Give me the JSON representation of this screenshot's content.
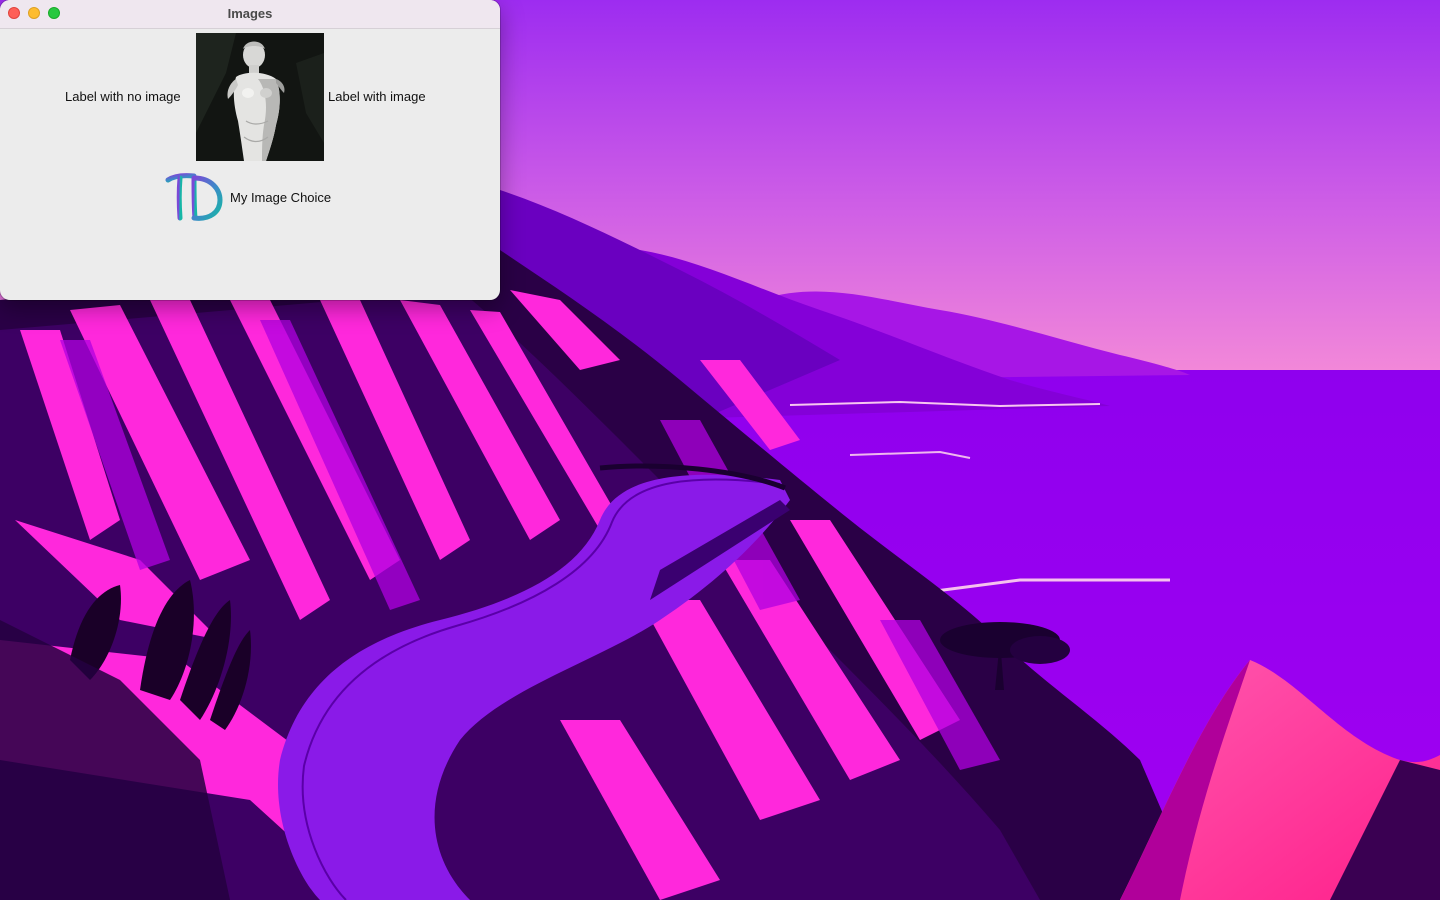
{
  "window": {
    "title": "Images"
  },
  "labels": {
    "no_image": "Label with no image",
    "with_image": "Label with image",
    "choice": "My Image Choice"
  },
  "images": {
    "statue": "statue-photo",
    "logo": "td-logo"
  },
  "colors": {
    "window_bg": "#ececec",
    "titlebar_bg": "#efe7ef",
    "close": "#fe5f57",
    "minimize": "#febc2e",
    "maximize": "#28c840",
    "sky_top": "#9d2cf0",
    "sky_bottom": "#f48ad8",
    "sea": "#9a00f0",
    "cliff_magenta": "#ff28dc",
    "road": "#8a1ae8",
    "logo_teal": "#16b7a6",
    "logo_purple": "#7b49d6"
  }
}
